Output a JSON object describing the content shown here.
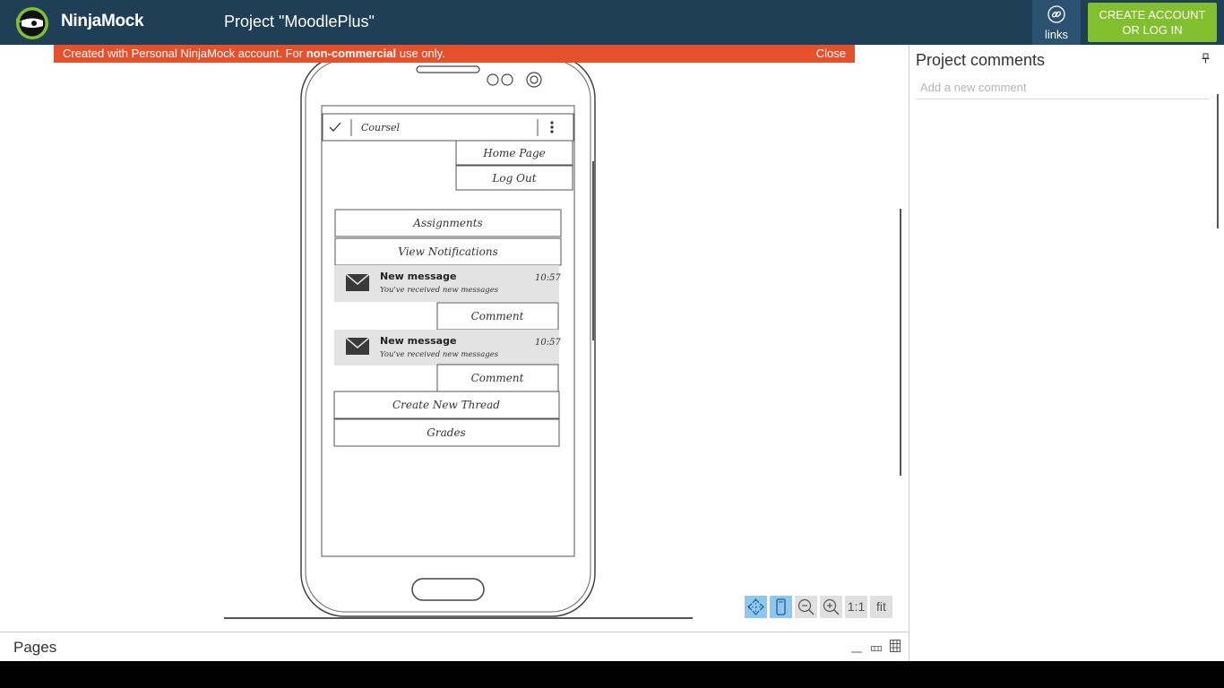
{
  "topbar": {
    "brand": "NinjaMock",
    "project_title": "Project \"MoodlePlus\"",
    "links_label": "links",
    "create_account_line1": "CREATE ACCOUNT",
    "create_account_line2": "OR LOG IN"
  },
  "notice": {
    "text_before": "Created with Personal NinjaMock account. For ",
    "text_bold": "non-commercial",
    "text_after": " use only.",
    "close_label": "Close"
  },
  "mockup": {
    "toolbar_title": "Coursel",
    "menu_items": [
      "Home Page",
      "Log Out"
    ],
    "buttons": {
      "assignments": "Assignments",
      "view_notifications": "View Notifications",
      "comment_1": "Comment",
      "comment_2": "Comment",
      "create_thread": "Create New Thread",
      "grades": "Grades"
    },
    "notifications": [
      {
        "title": "New message",
        "subtitle": "You've received new messages",
        "time": "10:57"
      },
      {
        "title": "New message",
        "subtitle": "You've received new messages",
        "time": "10:57"
      }
    ]
  },
  "zoom": {
    "one_to_one": "1:1",
    "fit": "fit"
  },
  "comments": {
    "title": "Project comments",
    "placeholder": "Add a new comment"
  },
  "pages": {
    "title": "Pages"
  },
  "icons": {
    "logo": "ninja-head-icon",
    "links": "link-icon",
    "pin": "pin-icon",
    "mail": "envelope-icon",
    "check": "check-icon",
    "overflow": "more-vert-icon"
  },
  "colors": {
    "topbar": "#1e3f56",
    "links_button": "#2b5270",
    "create_button": "#82bf2f",
    "notice": "#e5512c",
    "zoom_active": "#8cc8f0",
    "notification_bg": "#e3e3e3"
  }
}
